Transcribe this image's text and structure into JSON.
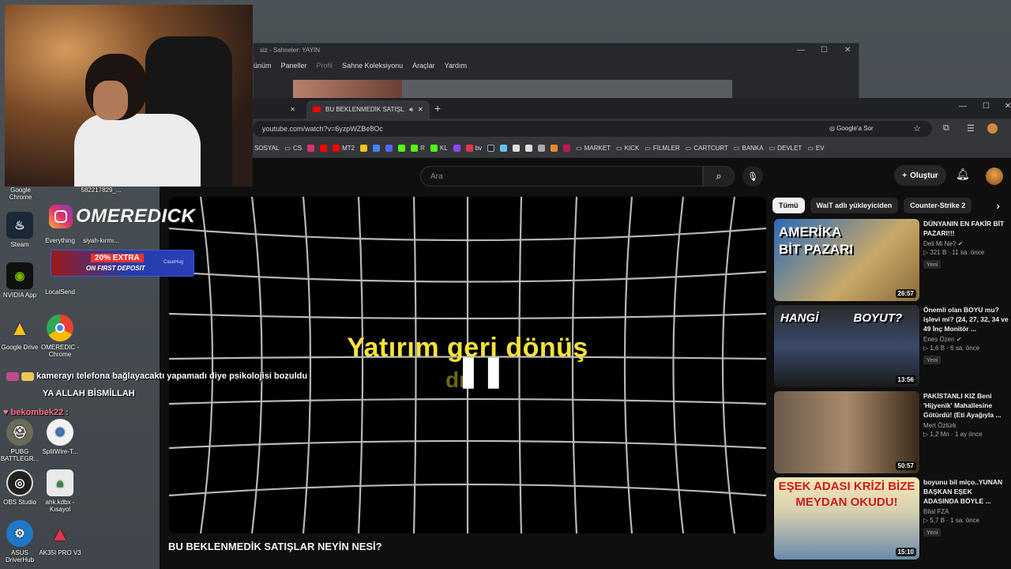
{
  "desktop": {
    "icons": [
      {
        "label": "Google Chrome",
        "icon": "chrome-icon"
      },
      {
        "label": "582217829_...",
        "icon": "file-icon"
      },
      {
        "label": "Steam",
        "icon": "steam-icon"
      },
      {
        "label": "Everything",
        "icon": "search-icon"
      },
      {
        "label": "siyah-kırmı...",
        "icon": "file-icon"
      },
      {
        "label": "NVIDIA App",
        "icon": "nvidia-icon"
      },
      {
        "label": "LocalSend",
        "icon": "localsend-icon"
      },
      {
        "label": "Google Drive",
        "icon": "google-drive-icon"
      },
      {
        "label": "OMEREDIC - Chrome",
        "icon": "chrome-icon"
      },
      {
        "label": "PUBG BATTLEGR...",
        "icon": "pubg-icon"
      },
      {
        "label": "SplitWire-T...",
        "icon": "gear-icon"
      },
      {
        "label": "OBS Studio",
        "icon": "obs-icon"
      },
      {
        "label": "ahk.kdbx - Kısayol",
        "icon": "keepass-icon"
      },
      {
        "label": "ASUS DriverHub",
        "icon": "asus-icon"
      },
      {
        "label": "AK35I PRO V3",
        "icon": "ak-icon"
      }
    ]
  },
  "obs": {
    "title": "siz - Sahneler: YAYIN",
    "menu": [
      "ünüm",
      "Paneller",
      "Profil",
      "Sahne Koleksiyonu",
      "Araçlar",
      "Yardım"
    ]
  },
  "browser": {
    "tab_active": "BU BEKLENMEDİK SATIŞLAR",
    "url": "youtube.com/watch?v=6yzpWZBe8Oc",
    "ask_google": "Google'a Sor",
    "bookmarks": [
      "SOSYAL",
      "CS",
      "MT2",
      "R",
      "KL",
      "bv",
      "MARKET",
      "KICK",
      "FİLMLER",
      "CARTCURT",
      "BANKA",
      "DEVLET",
      "EV"
    ]
  },
  "youtube": {
    "search_placeholder": "Ara",
    "create_label": "Oluştur",
    "video_overlay": "Yatırım geri dönüş",
    "video_overlay_2": "dı",
    "video_title": "BU BEKLENMEDİK SATIŞLAR NEYİN NESİ?",
    "chips": [
      "Tümü",
      "WaiT adlı yükleyiciden",
      "Counter-Strike 2"
    ],
    "recommendations": [
      {
        "title": "DÜNYANIN EN FAKİR BİT PAZARI!!!",
        "channel": "Deli Mi Ne?",
        "views": "321 B",
        "age": "11 sa. önce",
        "badge": "Yeni",
        "duration": "26:57",
        "thumb_text": "AMERİKA BİT PAZARI"
      },
      {
        "title": "Önemli olan BOYU mu? işlevi mi? (24, 27, 32, 34 ve 49 İnç Monitör ...",
        "channel": "Enes Özen",
        "views": "1,6 B",
        "age": "6 sa. önce",
        "badge": "Yeni",
        "duration": "13:56",
        "thumb_text": "HANGİ BOYUT?"
      },
      {
        "title": "PAKİSTANLI KIZ Beni 'Hijyenik' Mahallesine Götürdü! (Eti Ayağıyla ...",
        "channel": "Mert Öztürk",
        "views": "1,2 Mn",
        "age": "1 ay önce",
        "badge": "",
        "duration": "50:57",
        "thumb_text": ""
      },
      {
        "title": "boyunu bil miço..YUNAN BAŞKAN EŞEK ADASINDA BÖYLE ...",
        "channel": "Bilal FZA",
        "views": "5,7 B",
        "age": "1 sa. önce",
        "badge": "Yeni",
        "duration": "15:10",
        "thumb_text": "EŞEK ADASI KRİZİ BİZE MEYDAN OKUDU!"
      }
    ]
  },
  "stream": {
    "logo_text": "OMEREDICK",
    "promo_line1": "20% EXTRA",
    "promo_line2": "ON FIRST DEPOSIT",
    "promo_brand": "CaseHug",
    "chat": [
      {
        "user": "",
        "message": "kamerayı telefona bağlayacaktı yapamadı diye psikolojisi bozuldu"
      },
      {
        "user": "",
        "message": "YA ALLAH BİSMİLLAH"
      },
      {
        "user": "bekombek22 :",
        "message": ""
      }
    ]
  }
}
